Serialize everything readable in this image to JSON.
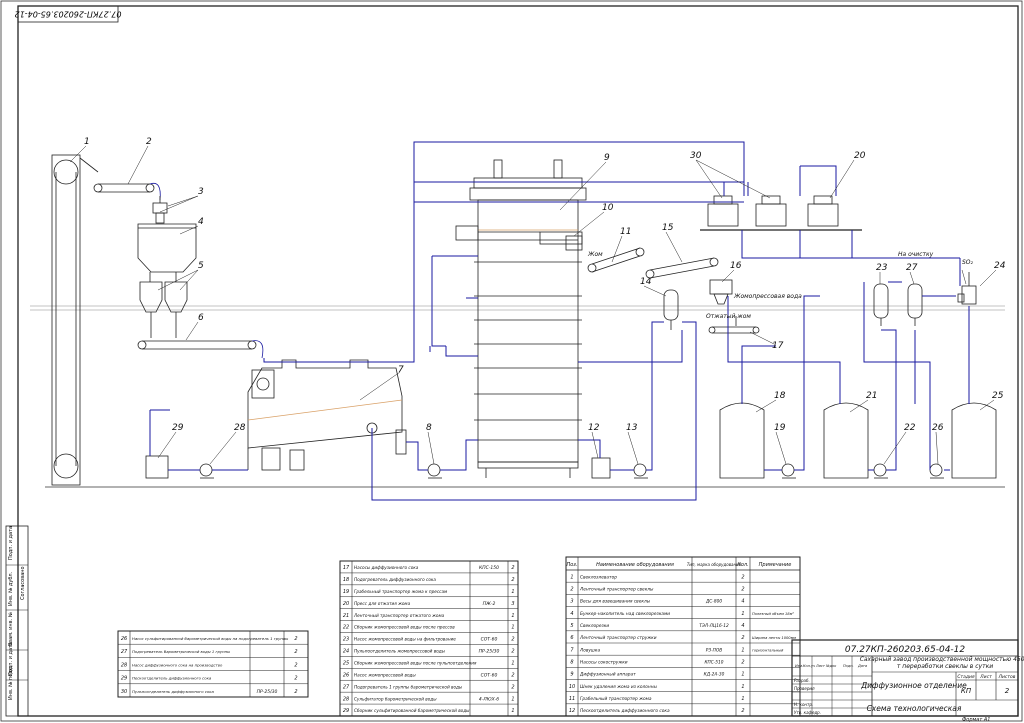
{
  "drawing_code": "07.27КП-260203.65-04-12",
  "stamp_code_rotated": "07.27КП-260203.65-04-12",
  "side_stamp_labels": [
    "Инв. № подл.",
    "Подп. и дата",
    "Взам. инв. №",
    "Инв. № дубл.",
    "Подп. и дата",
    "Согласовано"
  ],
  "position_labels": [
    "1",
    "2",
    "3",
    "4",
    "5",
    "6",
    "7",
    "8",
    "9",
    "10",
    "11",
    "12",
    "13",
    "14",
    "15",
    "16",
    "17",
    "18",
    "19",
    "20",
    "21",
    "22",
    "23",
    "24",
    "25",
    "26",
    "27",
    "28",
    "29",
    "30"
  ],
  "flow_labels": {
    "pulp": "Жом",
    "to_cleaning": "На очистку",
    "press_water": "Жомопрессовая вода",
    "spent_pulp": "Отжатый жом",
    "so2": "SO₂"
  },
  "equipment_table_center": {
    "rows": [
      {
        "pos": "17",
        "name": "Насосы диффузионного сока",
        "mark": "КПС-150",
        "qty": "2",
        "note": ""
      },
      {
        "pos": "18",
        "name": "Подогреватель диффузионного сока",
        "mark": "",
        "qty": "2",
        "note": ""
      },
      {
        "pos": "19",
        "name": "Грабельный транспортер жома к прессам",
        "mark": "",
        "qty": "1",
        "note": ""
      },
      {
        "pos": "20",
        "name": "Пресс для отжатия жома",
        "mark": "ПЖ-2",
        "qty": "3",
        "note": ""
      },
      {
        "pos": "21",
        "name": "Ленточный транспортер отжатого жома",
        "mark": "",
        "qty": "1",
        "note": ""
      },
      {
        "pos": "22",
        "name": "Сборник жомопрессовой воды после прессов",
        "mark": "",
        "qty": "1",
        "note": ""
      },
      {
        "pos": "23",
        "name": "Насос жомопрессовой воды на фильтрование",
        "mark": "СОТ-60",
        "qty": "2",
        "note": ""
      },
      {
        "pos": "24",
        "name": "Пульпоотделитель жомопрессовой воды",
        "mark": "ПР-25/30",
        "qty": "2",
        "note": ""
      },
      {
        "pos": "25",
        "name": "Сборник жомопрессовой воды после пульпоотделения",
        "mark": "",
        "qty": "1",
        "note": ""
      },
      {
        "pos": "26",
        "name": "Насос жомопрессовой воды",
        "mark": "СОТ-60",
        "qty": "2",
        "note": ""
      },
      {
        "pos": "27",
        "name": "Подогреватель 1 группы барометрической воды",
        "mark": "",
        "qty": "2",
        "note": ""
      },
      {
        "pos": "28",
        "name": "Сульфитатор барометрической воды",
        "mark": "4-ЛЮХ-6",
        "qty": "1",
        "note": ""
      },
      {
        "pos": "29",
        "name": "Сборник сульфитированной барометрической воды",
        "mark": "",
        "qty": "1",
        "note": ""
      }
    ]
  },
  "equipment_table_right": {
    "headers": {
      "pos": "Поз.",
      "name": "Наименование оборудования",
      "mark": "Тип, марка оборудования",
      "qty": "Кол.",
      "note": "Примечание"
    },
    "rows": [
      {
        "pos": "1",
        "name": "Свеклоэлеватор",
        "mark": "",
        "qty": "2",
        "note": ""
      },
      {
        "pos": "2",
        "name": "Ленточный транспортер свеклы",
        "mark": "",
        "qty": "2",
        "note": ""
      },
      {
        "pos": "3",
        "name": "Весы для взвешивания свеклы",
        "mark": "ДС-800",
        "qty": "4",
        "note": ""
      },
      {
        "pos": "4",
        "name": "Бункер-накопитель над свеклорезками",
        "mark": "",
        "qty": "1",
        "note": "Полезный объем 18м³"
      },
      {
        "pos": "5",
        "name": "Свеклорезки",
        "mark": "ТЭЛ-ЛЦ16-12",
        "qty": "4",
        "note": ""
      },
      {
        "pos": "6",
        "name": "Ленточный транспортер стружки",
        "mark": "",
        "qty": "2",
        "note": "Ширина ленты 1000мм"
      },
      {
        "pos": "7",
        "name": "Ловушка",
        "mark": "РЗ-ПОВ",
        "qty": "1",
        "note": "горизонтальный"
      },
      {
        "pos": "8",
        "name": "Насосы сокостружки",
        "mark": "КПС-510",
        "qty": "2",
        "note": ""
      },
      {
        "pos": "9",
        "name": "Диффузионный аппарат",
        "mark": "КД-2А-30",
        "qty": "1",
        "note": ""
      },
      {
        "pos": "10",
        "name": "Шнек удаления жома из колонны",
        "mark": "",
        "qty": "1",
        "note": ""
      },
      {
        "pos": "11",
        "name": "Грабельный транспортер жома",
        "mark": "",
        "qty": "1",
        "note": ""
      },
      {
        "pos": "12",
        "name": "Пескоотделитель диффузионного сока",
        "mark": "",
        "qty": "2",
        "note": ""
      }
    ]
  },
  "equipment_table_left": {
    "rows": [
      {
        "pos": "26",
        "name": "Насос сульфитированной барометрической воды на подогреватель 1 группы",
        "mark": "",
        "qty": "2"
      },
      {
        "pos": "27",
        "name": "Подогреватель барометрической воды 1 группы",
        "mark": "",
        "qty": "2"
      },
      {
        "pos": "28",
        "name": "Насос диффузионного сока на производство",
        "mark": "",
        "qty": "2"
      },
      {
        "pos": "29",
        "name": "Пескоотделитель диффузионного сока",
        "mark": "",
        "qty": "2"
      },
      {
        "pos": "30",
        "name": "Пульпоотделитель диффузионного сока",
        "mark": "ПР-25/30",
        "qty": "2"
      }
    ]
  },
  "title_block": {
    "code": "07.27КП-260203.65-04-12",
    "project": "Сахарный завод производственной мощностью 4500 т переработки свеклы в сутки",
    "department": "Диффузионное отделение",
    "sheet_title": "Схема технологическая",
    "stage_header": "Стадия",
    "sheet_header": "Лист",
    "sheets_header": "Листов",
    "stage": "КП",
    "sheets": "2",
    "roles": [
      "Изм.",
      "Кол.уч",
      "Лист",
      "№док",
      "Подп.",
      "Дата",
      "Разраб.",
      "Проверил",
      "Н. контр.",
      "Утв. кафедр."
    ],
    "format": "Формат А1"
  }
}
